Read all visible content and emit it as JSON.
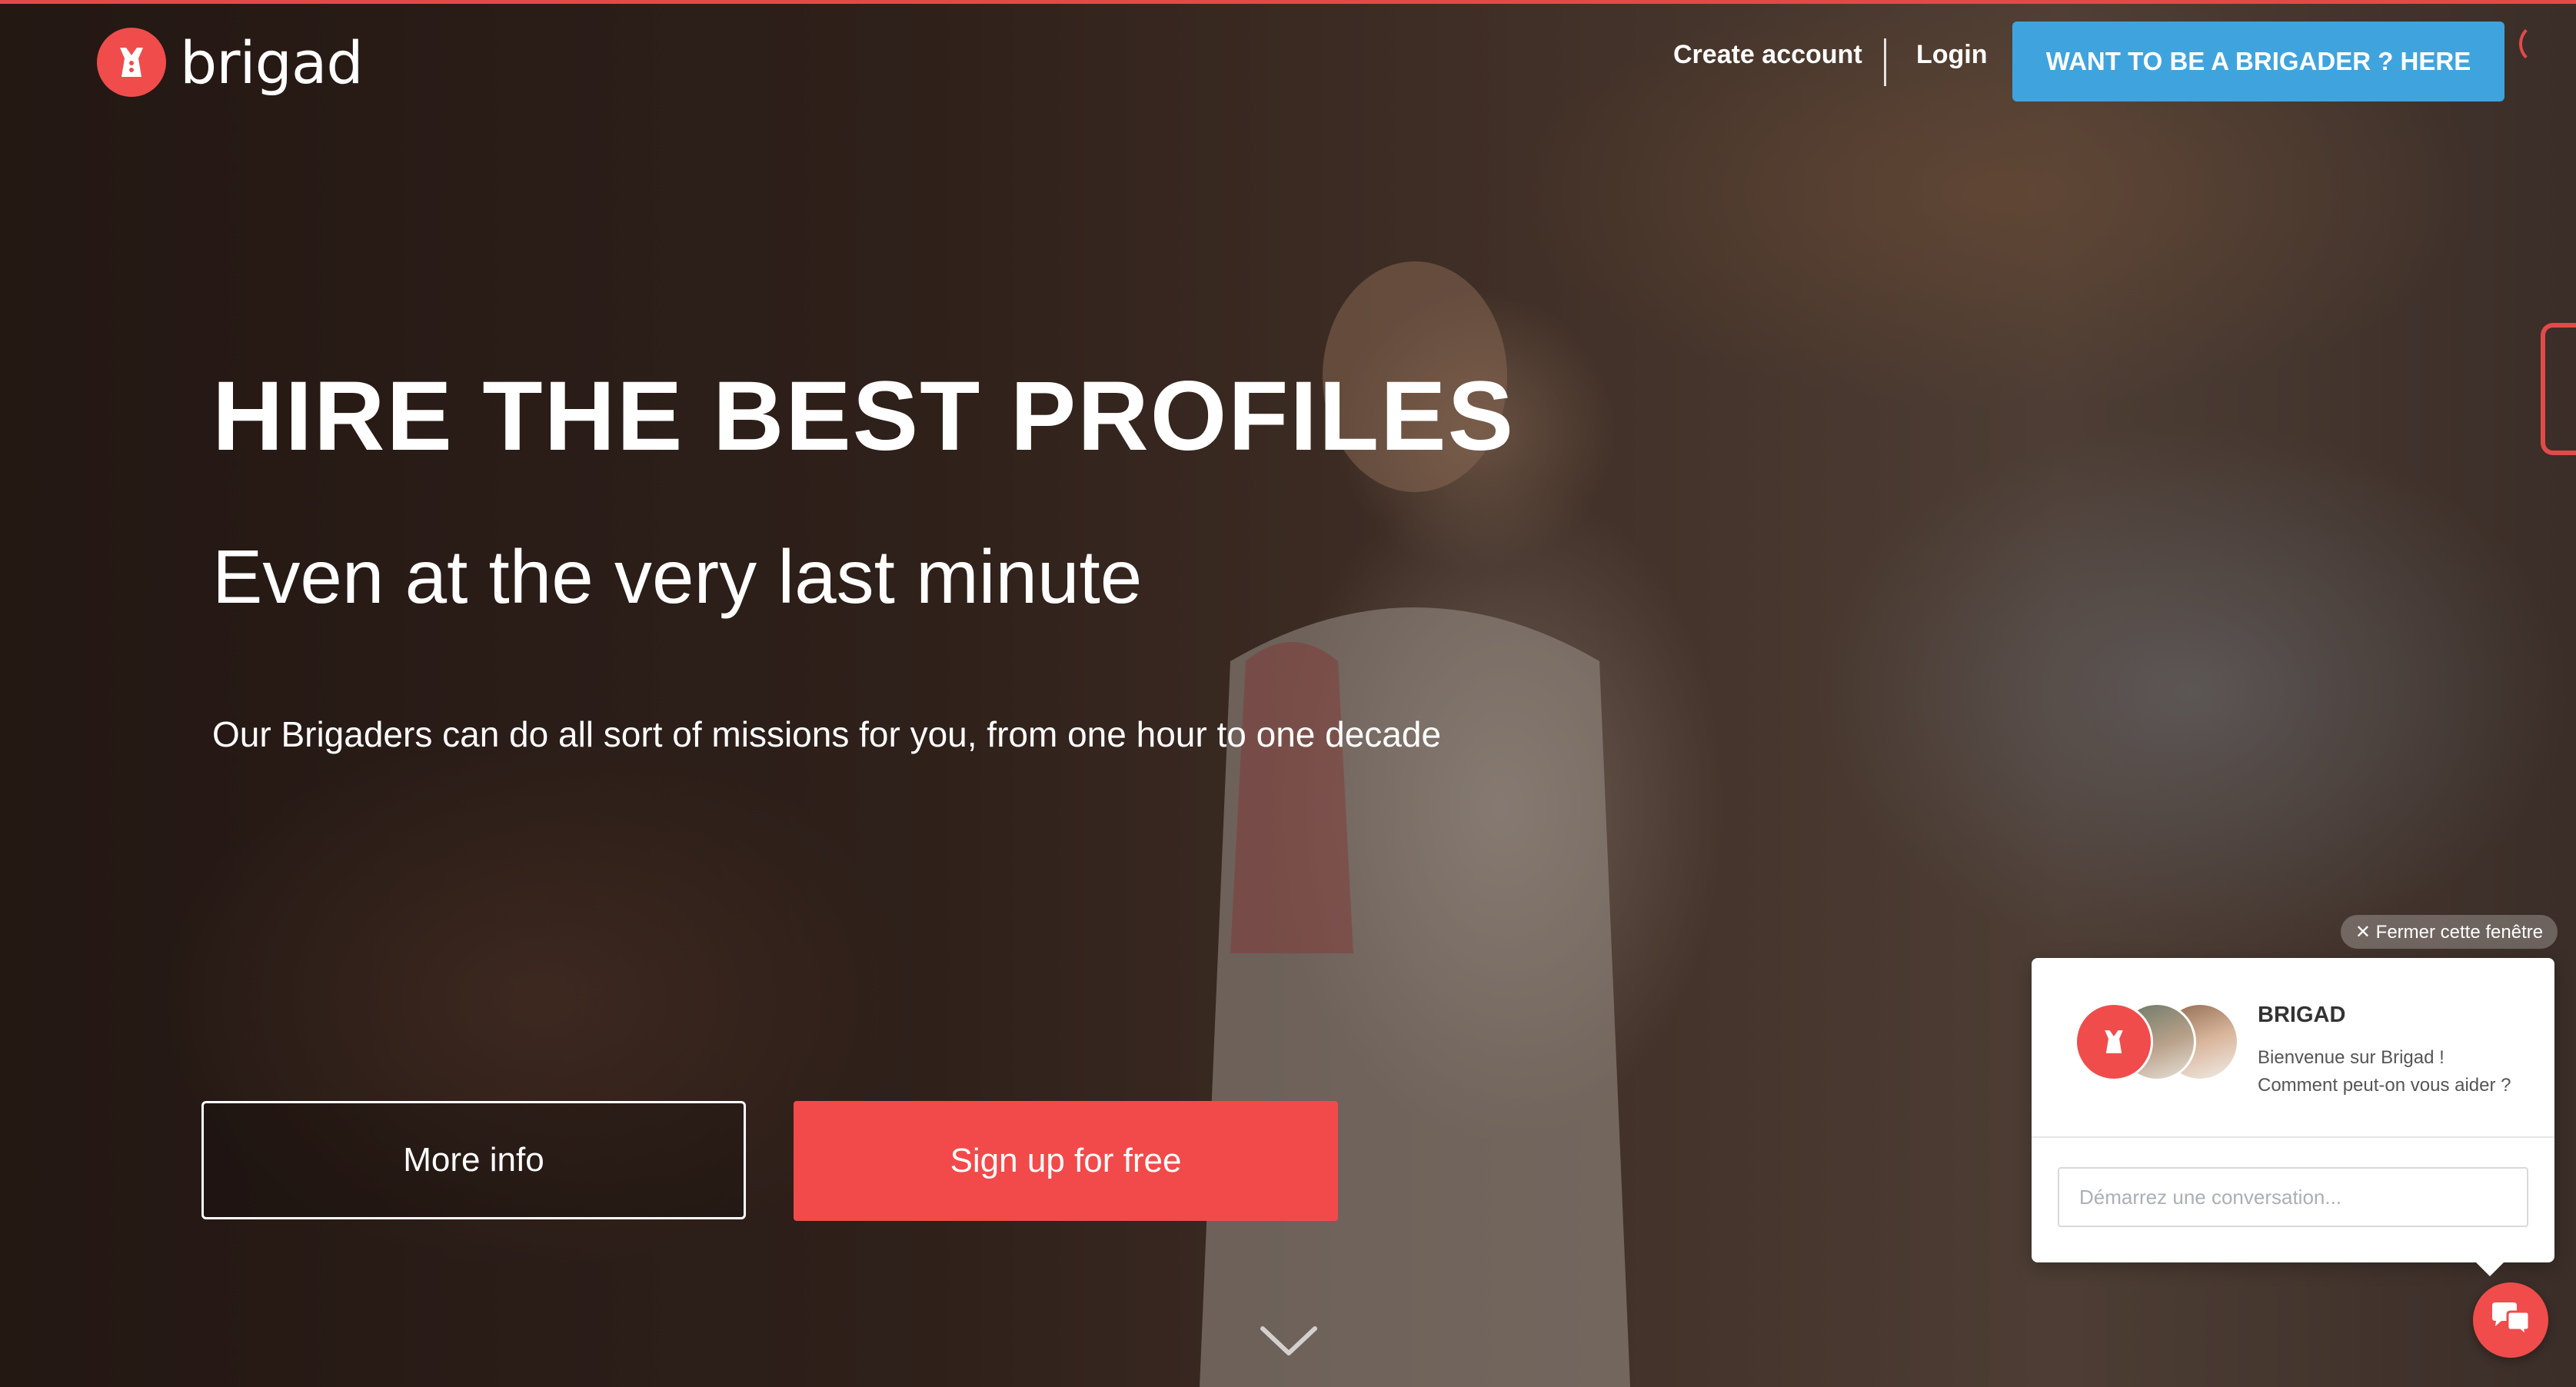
{
  "header": {
    "logo_text": "brigad",
    "nav": {
      "create_account": "Create account",
      "login": "Login"
    },
    "cta_brigader": "WANT TO BE A BRIGADER ? HERE"
  },
  "hero": {
    "title": "HIRE THE BEST PROFILES",
    "subtitle": "Even at the very last minute",
    "description": "Our Brigaders can do all sort of missions for you, from one hour to one decade",
    "more_info_label": "More info",
    "signup_label": "Sign up for free"
  },
  "chat": {
    "close_label": "✕ Fermer cette fenêtre",
    "name": "BRIGAD",
    "welcome_line1": "Bienvenue sur Brigad !",
    "welcome_line2": "Comment peut-on vous aider ?",
    "input_placeholder": "Démarrez une conversation..."
  },
  "colors": {
    "brand_red": "#f04c4c",
    "cta_blue": "#3fa4de",
    "text_white": "#ffffff"
  },
  "icons": {
    "logo": "brigad-logo-icon",
    "scroll": "chevron-down-icon",
    "chat_fab": "chat-bubbles-icon"
  }
}
